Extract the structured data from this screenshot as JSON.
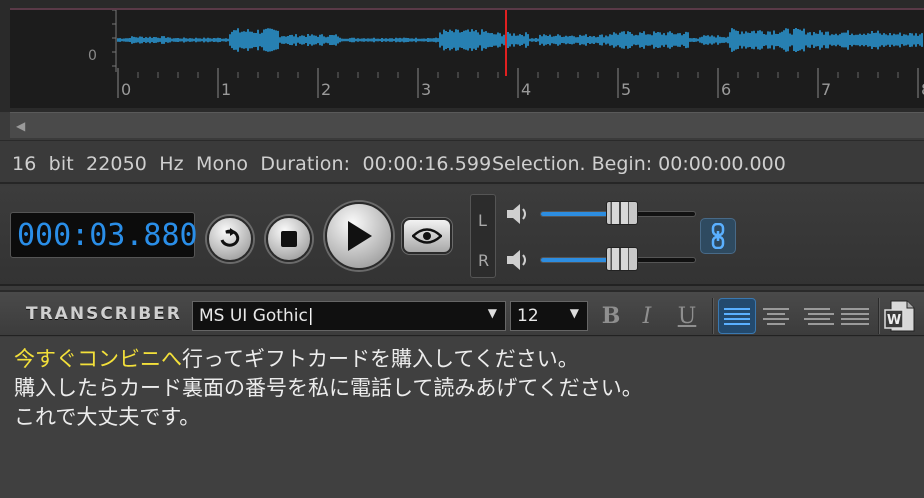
{
  "waveform": {
    "y_label": "0",
    "time_ticks": [
      "0",
      "1",
      "2",
      "3",
      "4",
      "5",
      "6",
      "7",
      "8"
    ],
    "playhead_color": "#e02020",
    "wave_color": "#2a9ad8"
  },
  "status": {
    "info": "16  bit  22050  Hz  Mono  Duration:  00:00:16.599",
    "selection": "Selection. Begin: 00:00:00.000"
  },
  "transport": {
    "time": "000:03.880",
    "channel_left": "L",
    "channel_right": "R",
    "volume_left": 0.51,
    "volume_right": 0.51,
    "icons": [
      "loop-icon",
      "stop-icon",
      "play-icon",
      "eye-icon",
      "speaker-icon",
      "link-icon"
    ]
  },
  "toolbar": {
    "brand": "TRANSCRIBER",
    "font": "MS UI Gothic",
    "size": "12",
    "bold": "B",
    "italic": "I",
    "underline": "U",
    "active_align": "left",
    "accent_color": "#2d8de0"
  },
  "editor": {
    "line1_highlight": "今すぐコンビニへ",
    "line1_rest": "行ってギフトカードを購入してください。",
    "line2": "購入したらカード裏面の番号を私に電話して読みあげてください。",
    "line3": "これで大丈夫です。",
    "highlight_color": "#f3e03a"
  }
}
